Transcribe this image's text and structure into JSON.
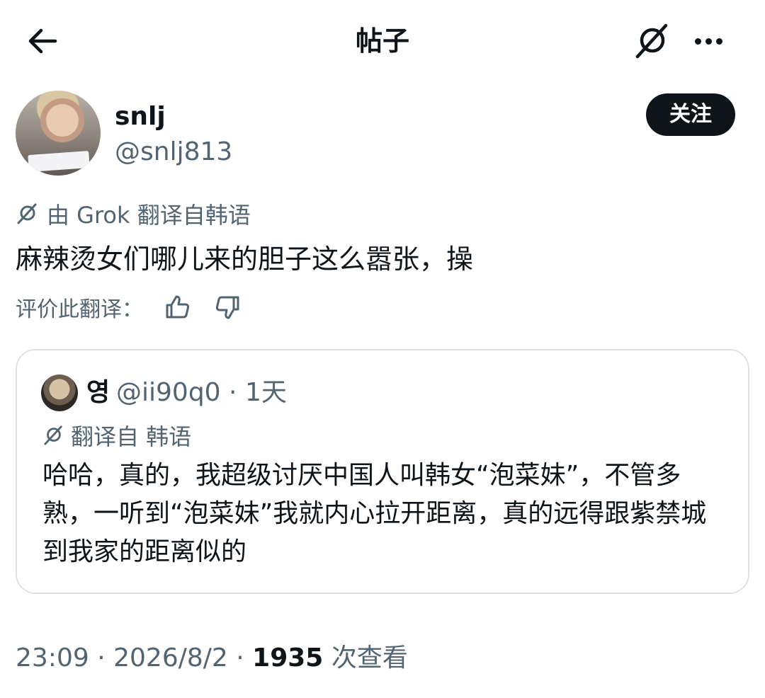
{
  "header": {
    "title": "帖子",
    "back_icon": "arrow-left-icon",
    "grok_icon": "grok-icon",
    "more_icon": "more-horizontal-icon"
  },
  "author": {
    "name": "snlj",
    "handle": "@snlj813",
    "follow_label": "关注"
  },
  "translation": {
    "notice": "由 Grok 翻译自韩语",
    "text": "麻辣烫女们哪儿来的胆子这么嚣张，操",
    "rate_label": "评价此翻译：",
    "thumbs_up_icon": "thumbs-up-icon",
    "thumbs_down_icon": "thumbs-down-icon"
  },
  "quote": {
    "name": "영",
    "handle": "@ii90q0",
    "separator": "·",
    "time": "1天",
    "notice": "翻译自 韩语",
    "text": "哈哈，真的，我超级讨厌中国人叫韩女“泡菜妹”，不管多熟，一听到“泡菜妹”我就内心拉开距离，真的远得跟紫禁城到我家的距离似的"
  },
  "meta": {
    "time": "23:09",
    "sep1": "·",
    "date": "2026/8/2",
    "sep2": "·",
    "views": "1935",
    "views_label": "次查看"
  },
  "colors": {
    "text": "#0f1419",
    "secondary": "#536471",
    "border": "#dfe3e7",
    "button": "#0f1419"
  }
}
